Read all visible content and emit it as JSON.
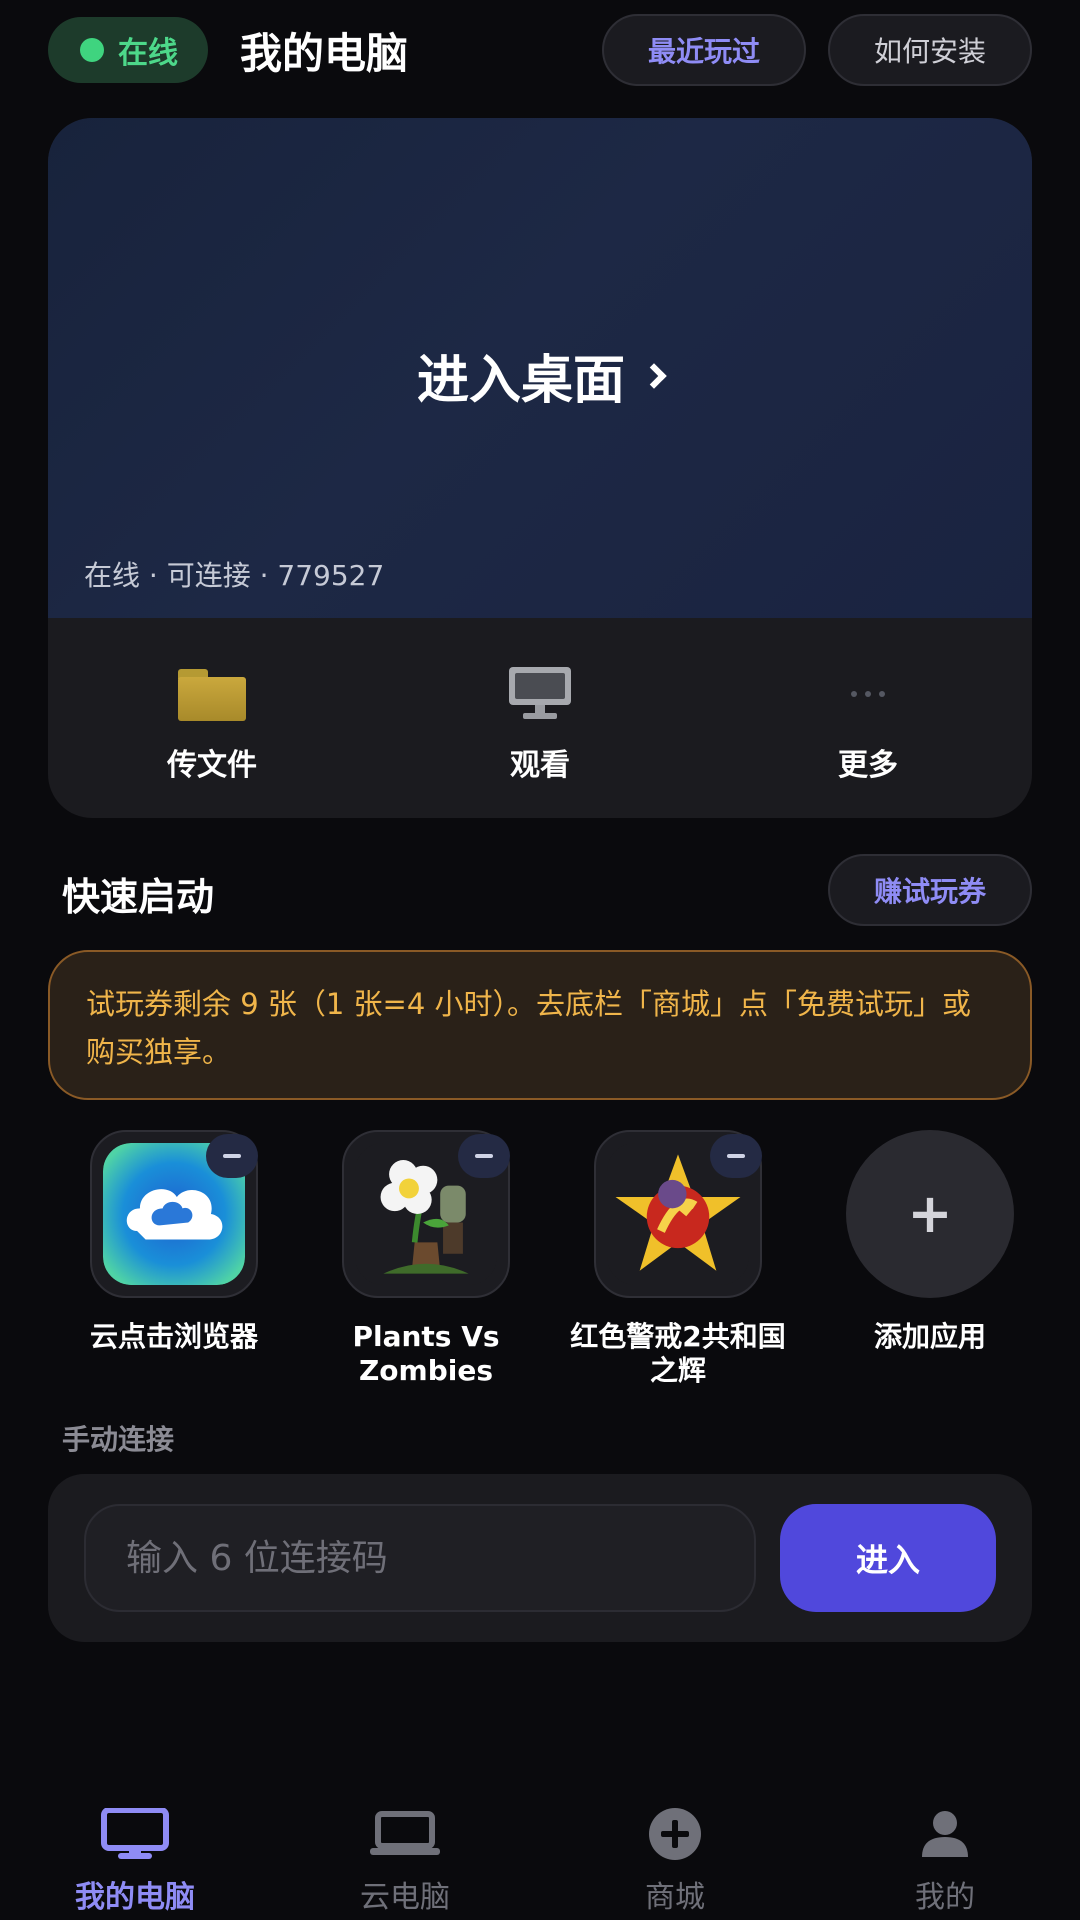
{
  "header": {
    "status": "在线",
    "title": "我的电脑",
    "recent_label": "最近玩过",
    "howto_label": "如何安装"
  },
  "desktop_card": {
    "enter_label": "进入桌面",
    "info": "在线 · 可连接 · 779527",
    "actions": [
      {
        "label": "传文件",
        "icon": "folder-icon"
      },
      {
        "label": "观看",
        "icon": "monitor-icon"
      },
      {
        "label": "更多",
        "icon": "more-icon"
      }
    ]
  },
  "quick_start": {
    "title": "快速启动",
    "earn_label": "赚试玩券",
    "notice": "试玩券剩余 9 张（1 张=4 小时）。去底栏「商城」点「免费试玩」或购买独享。",
    "apps": [
      {
        "label": "云点击浏览器",
        "icon": "cloud-browser-icon"
      },
      {
        "label": "Plants Vs Zombies",
        "icon": "plants-vs-zombies-icon"
      },
      {
        "label": "红色警戒2共和国之辉",
        "icon": "red-alert-icon"
      },
      {
        "label": "添加应用",
        "icon": "plus-icon"
      }
    ]
  },
  "manual_connect": {
    "label": "手动连接",
    "placeholder": "输入 6 位连接码",
    "value": "",
    "enter_label": "进入"
  },
  "bottom_nav": [
    {
      "label": "我的电脑",
      "icon": "monitor-icon",
      "active": true
    },
    {
      "label": "云电脑",
      "icon": "laptop-icon",
      "active": false
    },
    {
      "label": "商城",
      "icon": "plus-circle-icon",
      "active": false
    },
    {
      "label": "我的",
      "icon": "person-icon",
      "active": false
    }
  ],
  "colors": {
    "accent": "#8f8cf5",
    "primary_button": "#5048dc",
    "online": "#4dd88a",
    "notice_text": "#f0b54a"
  }
}
